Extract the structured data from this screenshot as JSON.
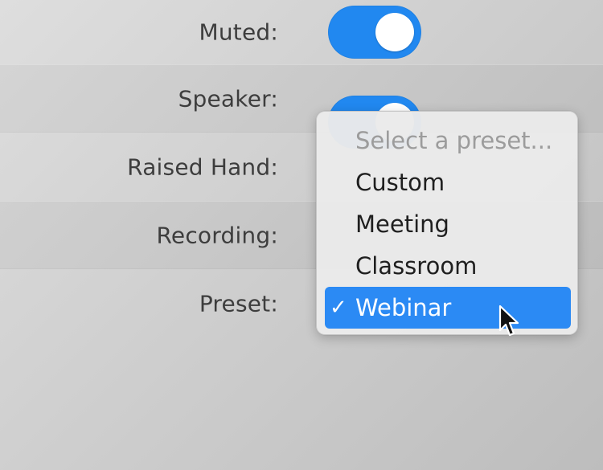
{
  "settings": {
    "rows": [
      {
        "label": "Muted:",
        "toggle_on": true
      },
      {
        "label": "Speaker:",
        "toggle_on": true
      },
      {
        "label": "Raised Hand:"
      },
      {
        "label": "Recording:"
      },
      {
        "label": "Preset:"
      }
    ]
  },
  "preset_menu": {
    "placeholder": "Select a preset...",
    "options": [
      "Custom",
      "Meeting",
      "Classroom",
      "Webinar"
    ],
    "selected": "Webinar",
    "check_glyph": "✓"
  },
  "colors": {
    "accent": "#2188f0",
    "selected_highlight": "#2b8af4"
  },
  "icons": {
    "cursor": "arrow-cursor-icon",
    "check": "checkmark-icon"
  }
}
